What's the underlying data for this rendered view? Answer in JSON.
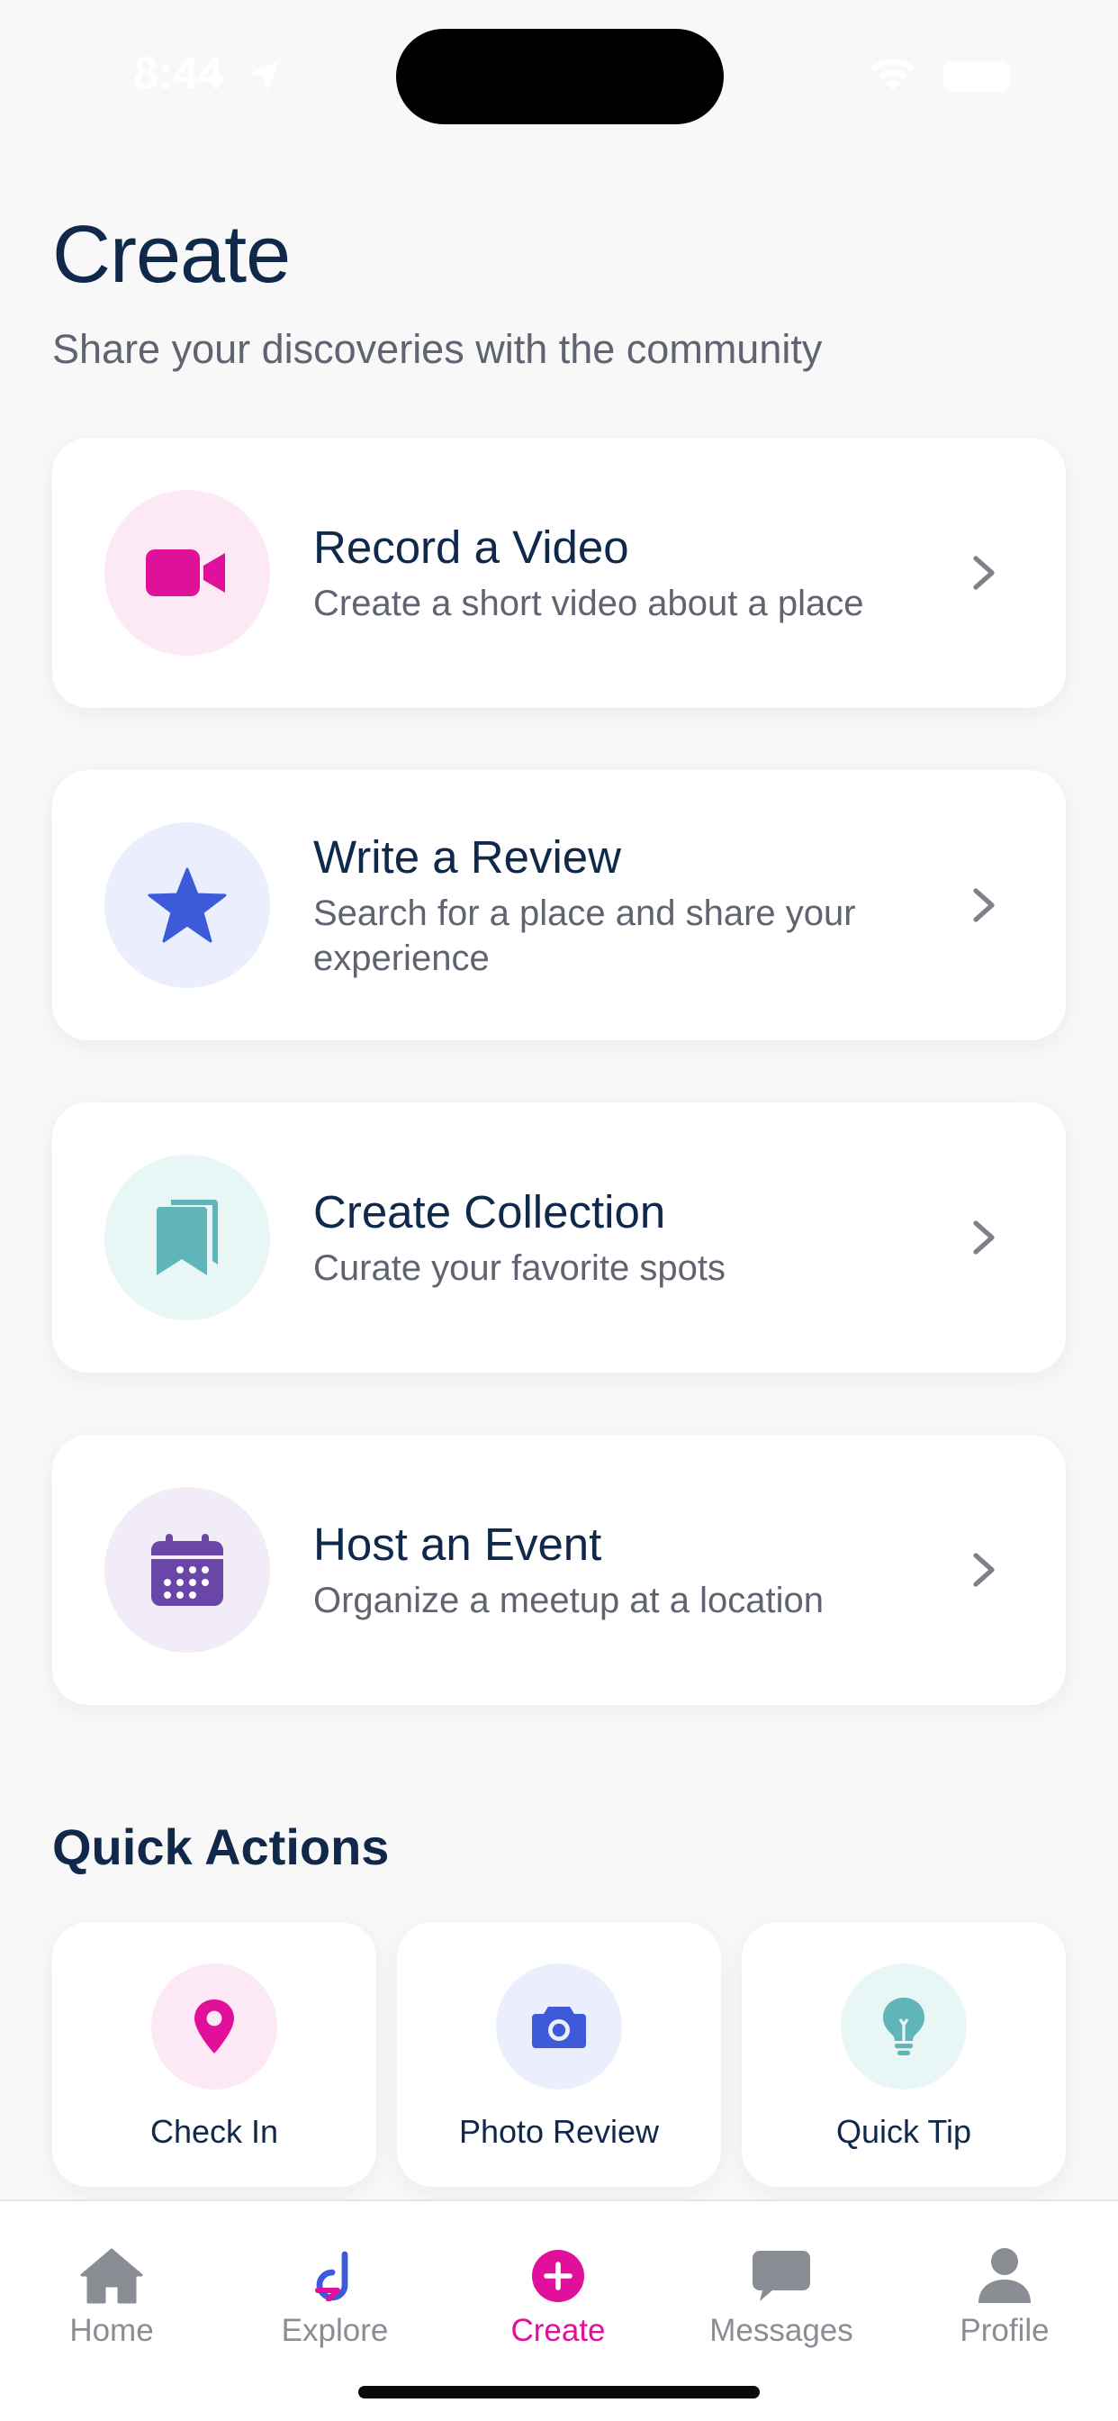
{
  "status_bar": {
    "time": "8:44"
  },
  "header": {
    "title": "Create",
    "subtitle": "Share your discoveries with the community"
  },
  "cards": [
    {
      "title": "Record a Video",
      "description": "Create a short video about a place",
      "icon": "video-camera-icon",
      "color": "#e0109a",
      "bg": "#fde8f5"
    },
    {
      "title": "Write a Review",
      "description": "Search for a place and share your experience",
      "icon": "star-icon",
      "color": "#3d5bd9",
      "bg": "#ebeefc"
    },
    {
      "title": "Create Collection",
      "description": "Curate your favorite spots",
      "icon": "bookmarks-icon",
      "color": "#5fb5b8",
      "bg": "#e9f6f6"
    },
    {
      "title": "Host an Event",
      "description": "Organize a meetup at a location",
      "icon": "calendar-icon",
      "color": "#6a46a8",
      "bg": "#f1ecf7"
    }
  ],
  "quick_actions": {
    "title": "Quick Actions",
    "items": [
      {
        "label": "Check In",
        "icon": "location-pin-icon",
        "color": "#e0109a",
        "bg": "#fde8f5"
      },
      {
        "label": "Photo Review",
        "icon": "camera-icon",
        "color": "#3d5bd9",
        "bg": "#ebeefc"
      },
      {
        "label": "Quick Tip",
        "icon": "lightbulb-icon",
        "color": "#5fb5b8",
        "bg": "#e9f6f6"
      }
    ]
  },
  "tabs": [
    {
      "label": "Home",
      "icon": "home-icon",
      "active": false
    },
    {
      "label": "Explore",
      "icon": "explore-logo-icon",
      "active": false
    },
    {
      "label": "Create",
      "icon": "plus-circle-icon",
      "active": true
    },
    {
      "label": "Messages",
      "icon": "chat-bubble-icon",
      "active": false
    },
    {
      "label": "Profile",
      "icon": "person-icon",
      "active": false
    }
  ],
  "colors": {
    "accent": "#e0109a",
    "text_primary": "#10284a",
    "text_secondary": "#5f6470",
    "tab_inactive": "#8a8d93"
  }
}
